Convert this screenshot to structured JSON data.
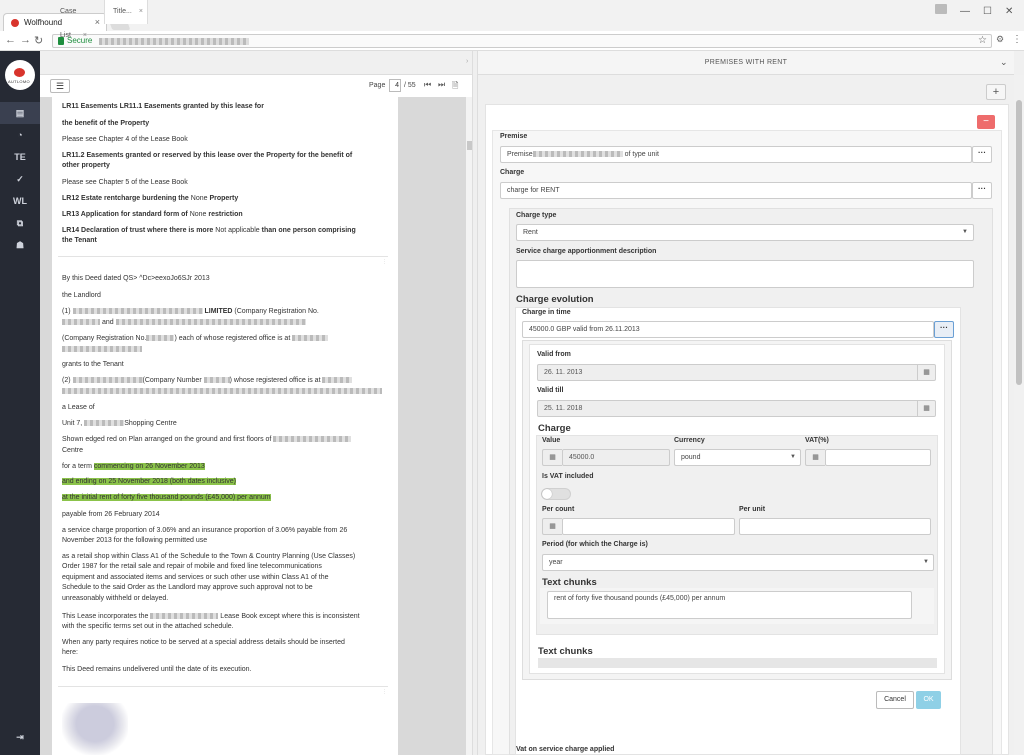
{
  "browser": {
    "tab_title": "Wolfhound",
    "secure_label": "Secure"
  },
  "sidebar": {
    "logo_text": "AUTLOMO",
    "items": [
      {
        "name": "book-icon",
        "glyph": "▤"
      },
      {
        "name": "dashboard-icon",
        "glyph": "◔"
      },
      {
        "name": "te",
        "glyph": "TE"
      },
      {
        "name": "check-icon",
        "glyph": "✓"
      },
      {
        "name": "wl",
        "glyph": "WL"
      },
      {
        "name": "copy-icon",
        "glyph": "⧉"
      },
      {
        "name": "user-icon",
        "glyph": "☗"
      }
    ],
    "logout_glyph": "⇥"
  },
  "left": {
    "tabs": [
      "Case List",
      "Title..."
    ],
    "page_label": "Page",
    "page_current": "4",
    "page_total": "/ 55"
  },
  "doc": {
    "lr11_1": "LR11 Easements LR11.1 Easements granted by this lease for",
    "lr11_2": "the benefit of the Property",
    "see4": "Please see Chapter 4 of the Lease Book",
    "lr112_1": "LR11.2 Easements granted or reserved by this lease over the Property for the benefit of",
    "lr112_2": "other property",
    "see5": "Please see Chapter 5 of the Lease Book",
    "lr12_a": "LR12 Estate rentcharge burdening the",
    "lr12_b": "None",
    "lr12_c": "Property",
    "lr13_a": "LR13 Application for standard form of",
    "lr13_b": "None",
    "lr13_c": "restriction",
    "lr14_a": "LR14 Declaration of trust where there is more",
    "lr14_b": "Not applicable",
    "lr14_c": "than one person comprising",
    "lr14_d": "the Tenant",
    "deed": "By this Deed dated QS> ^Dc>eexoJo6SJr 2013",
    "landlord": "the Landlord",
    "p1_a": "(1)",
    "p1_b": "LIMITED",
    "p1_c": "(Company Registration No.",
    "p1_d": "and",
    "p2_a": "(Company Registration No.",
    "p2_b": ") each of whose registered office is at",
    "grants": "grants to the Tenant",
    "t2_a": "(2)",
    "t2_b": "(Company Number",
    "t2_c": ") whose registered office is at",
    "alease": "a Lease of",
    "unit_a": "Unit 7,",
    "unit_b": "Shopping Centre",
    "shown": "Shown edged red on Plan arranged on the ground and first floors of",
    "centre": "Centre",
    "term_a": "for a term",
    "term_hl": "commencing on 26 November 2013",
    "ending_hl": "and ending on 25 November 2018 (both dates inclusive)",
    "rent_hl": "at the initial rent of forty five thousand pounds (£45,000) per annum",
    "payable": "payable from 26 February 2014",
    "sc_1": "a service charge proportion of 3.06% and an insurance proportion of 3.06% payable from 26",
    "sc_2": "November 2013 for the following permitted use",
    "use_1": "as a retail shop within Class A1 of the Schedule to the Town & Country Planning (Use Classes)",
    "use_2": "Order 1987 for the retail sale and repair of mobile and fixed line telecommunications",
    "use_3": "equipment and associated items and services or such other use within Class A1 of the",
    "use_4": "Schedule to the said Order as the Landlord may approve such approval not to be",
    "use_5": "unreasonably withheld or delayed.",
    "inc_a": "This Lease incorporates the",
    "inc_b": "Lease Book except where this is inconsistent",
    "inc_c": "with the specific terms set out in the attached schedule.",
    "when_1": "When any party requires notice to be served at a special address details should be inserted",
    "when_2": "here:",
    "undel": "This Deed remains undelivered until the date of its execution."
  },
  "right": {
    "title": "PREMISES WITH RENT",
    "premise_label": "Premise",
    "premise_value_a": "Premise",
    "premise_value_b": "of type unit",
    "charge_label": "Charge",
    "charge_value": "charge for RENT",
    "charge_type_label": "Charge type",
    "charge_type_value": "Rent",
    "service_label": "Service charge apportionment description",
    "evolution_heading": "Charge evolution",
    "cit_label": "Charge in time",
    "cit_value": "45000.0 GBP valid from 26.11.2013",
    "valid_from_label": "Valid from",
    "valid_from_value": "26. 11. 2013",
    "valid_till_label": "Valid till",
    "valid_till_value": "25. 11. 2018",
    "charge_heading": "Charge",
    "value_label": "Value",
    "value_value": "45000.0",
    "currency_label": "Currency",
    "currency_value": "pound",
    "vat_label": "VAT(%)",
    "is_vat_label": "Is VAT included",
    "per_count_label": "Per count",
    "per_unit_label": "Per unit",
    "period_label": "Period (for which the Charge is)",
    "period_value": "year",
    "text_chunks_heading": "Text chunks",
    "chunk_text": "rent of forty five thousand pounds (£45,000) per annum",
    "text_chunks_heading2": "Text chunks",
    "cancel_label": "Cancel",
    "ok_label": "OK",
    "vat_service_label": "Vat on service charge applied"
  }
}
